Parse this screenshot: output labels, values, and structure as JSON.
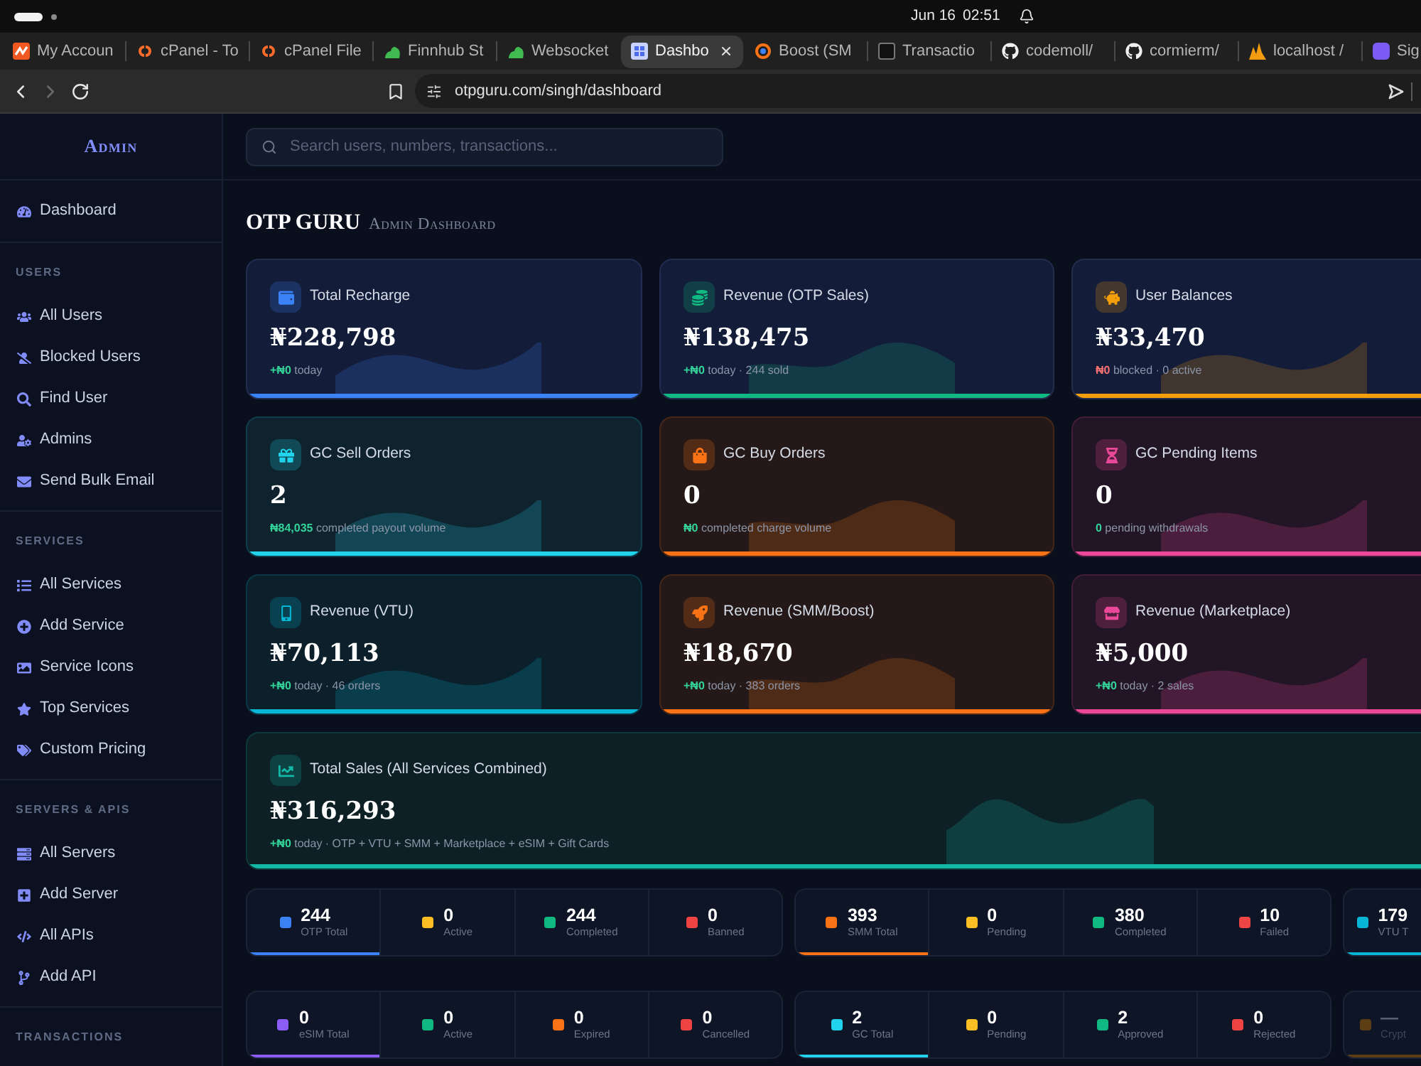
{
  "os_bar": {
    "workspaces": [
      {
        "selected": true
      },
      {
        "selected": false
      }
    ],
    "date": "Jun 16",
    "time": "02:51"
  },
  "browser": {
    "tabs": [
      {
        "title": "My Accoun",
        "selected": false
      },
      {
        "title": "cPanel - To",
        "selected": false
      },
      {
        "title": "cPanel File",
        "selected": false
      },
      {
        "title": "Finnhub St",
        "selected": false
      },
      {
        "title": "Websocket",
        "selected": false
      },
      {
        "title": "Dashbo",
        "selected": true
      },
      {
        "title": "Boost (SM",
        "selected": false
      },
      {
        "title": "Transactio",
        "selected": false
      },
      {
        "title": "codemoll/",
        "selected": false
      },
      {
        "title": "cormierm/",
        "selected": false
      },
      {
        "title": "localhost /",
        "selected": false
      },
      {
        "title": "Sig",
        "selected": false
      }
    ],
    "nav": {
      "back_enabled": true,
      "forward_enabled": false
    },
    "url": "otpguru.com/singh/dashboard"
  },
  "sidebar": {
    "title": "Admin",
    "sections": [
      {
        "items": [
          {
            "label": "Dashboard"
          }
        ]
      },
      {
        "heading": "USERS",
        "items": [
          {
            "label": "All Users"
          },
          {
            "label": "Blocked Users"
          },
          {
            "label": "Find User"
          },
          {
            "label": "Admins"
          },
          {
            "label": "Send Bulk Email"
          }
        ]
      },
      {
        "heading": "SERVICES",
        "items": [
          {
            "label": "All Services"
          },
          {
            "label": "Add Service"
          },
          {
            "label": "Service Icons"
          },
          {
            "label": "Top Services"
          },
          {
            "label": "Custom Pricing"
          }
        ]
      },
      {
        "heading": "SERVERS & APIS",
        "items": [
          {
            "label": "All Servers"
          },
          {
            "label": "Add Server"
          },
          {
            "label": "All APIs"
          },
          {
            "label": "Add API"
          }
        ]
      },
      {
        "heading": "TRANSACTIONS"
      }
    ]
  },
  "search": {
    "placeholder": "Search users, numbers, transactions..."
  },
  "page_title": {
    "brand": "OTP GURU",
    "subtitle": "Admin Dashboard"
  },
  "primary_cards": [
    {
      "title": "Total Recharge",
      "value": "₦228,798",
      "note": "**+₦0** today",
      "kind": "positive",
      "color": "#3b82f6"
    },
    {
      "title": "Revenue (OTP Sales)",
      "value": "₦138,475",
      "note": "**+₦0** today · 244 sold",
      "kind": "positive",
      "color": "#10b981"
    },
    {
      "title": "User Balances",
      "value": "₦33,470",
      "note": "**₦0** blocked · 0 active",
      "kind": "negative",
      "color": "#f59e0b"
    }
  ],
  "cards": [
    {
      "title": "GC Sell Orders",
      "value": "2",
      "note": "**₦84,035** completed payout volume",
      "kind": "positive",
      "color": "#22d3ee"
    },
    {
      "title": "GC Buy Orders",
      "value": "0",
      "note": "**₦0** completed charge volume",
      "kind": "positive",
      "color": "#f97316"
    },
    {
      "title": "GC Pending Items",
      "value": "0",
      "note": "**0** pending withdrawals",
      "kind": "positive",
      "color": "#ec4899"
    },
    {
      "title": "Revenue (VTU)",
      "value": "₦70,113",
      "note": "**+₦0** today · 46 orders",
      "kind": "positive",
      "color": "#06b6d4"
    },
    {
      "title": "Revenue (SMM/Boost)",
      "value": "₦18,670",
      "note": "**+₦0** today · 383 orders",
      "kind": "positive",
      "color": "#f97316"
    },
    {
      "title": "Revenue (Marketplace)",
      "value": "₦5,000",
      "note": "**+₦0** today · 2 sales",
      "kind": "positive",
      "color": "#ec4899"
    }
  ],
  "summary_card": {
    "title": "Total Sales (All Services Combined)",
    "value": "₦316,293",
    "note": "**+₦0** today · OTP + VTU + SMM + Marketplace + eSIM + Gift Cards",
    "kind": "positive",
    "color": "#14b8a6"
  },
  "stat_panels": [
    {
      "dimmed": false,
      "stats": [
        {
          "value": "244",
          "label": "OTP Total",
          "color": "#3b82f6"
        },
        {
          "value": "0",
          "label": "Active",
          "color": "#fbbf24"
        },
        {
          "value": "244",
          "label": "Completed",
          "color": "#10b981"
        },
        {
          "value": "0",
          "label": "Banned",
          "color": "#ef4444"
        }
      ]
    },
    {
      "dimmed": false,
      "stats": [
        {
          "value": "393",
          "label": "SMM Total",
          "color": "#f97316"
        },
        {
          "value": "0",
          "label": "Pending",
          "color": "#fbbf24"
        },
        {
          "value": "380",
          "label": "Completed",
          "color": "#10b981"
        },
        {
          "value": "10",
          "label": "Failed",
          "color": "#ef4444"
        }
      ]
    },
    {
      "dimmed": false,
      "stats": [
        {
          "value": "179",
          "label": "VTU T",
          "color": "#06b6d4"
        }
      ]
    },
    {
      "dimmed": false,
      "stats": [
        {
          "value": "0",
          "label": "eSIM Total",
          "color": "#8b5cf6"
        },
        {
          "value": "0",
          "label": "Active",
          "color": "#10b981"
        },
        {
          "value": "0",
          "label": "Expired",
          "color": "#f97316"
        },
        {
          "value": "0",
          "label": "Cancelled",
          "color": "#ef4444"
        }
      ]
    },
    {
      "dimmed": false,
      "stats": [
        {
          "value": "2",
          "label": "GC Total",
          "color": "#22d3ee"
        },
        {
          "value": "0",
          "label": "Pending",
          "color": "#fbbf24"
        },
        {
          "value": "2",
          "label": "Approved",
          "color": "#10b981"
        },
        {
          "value": "0",
          "label": "Rejected",
          "color": "#ef4444"
        }
      ]
    },
    {
      "dimmed": true,
      "stats": [
        {
          "value": "—",
          "label": "Crypt",
          "color": "#5c3d14"
        }
      ]
    }
  ]
}
